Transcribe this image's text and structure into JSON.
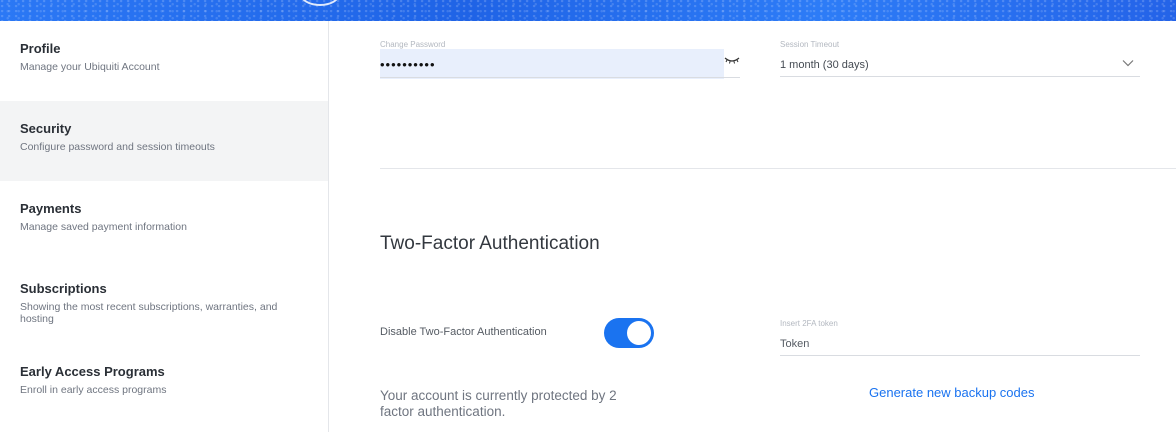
{
  "sidebar": {
    "items": [
      {
        "title": "Profile",
        "desc": "Manage your Ubiquiti Account"
      },
      {
        "title": "Security",
        "desc": "Configure password and session timeouts"
      },
      {
        "title": "Payments",
        "desc": "Manage saved payment information"
      },
      {
        "title": "Subscriptions",
        "desc": "Showing the most recent subscriptions, warranties, and hosting"
      },
      {
        "title": "Early Access Programs",
        "desc": "Enroll in early access programs"
      }
    ]
  },
  "security": {
    "password_label": "Change Password",
    "password_value": "••••••••••",
    "session_label": "Session Timeout",
    "session_value": "1 month (30 days)"
  },
  "two_factor": {
    "title": "Two-Factor Authentication",
    "toggle_label": "Disable Two-Factor Authentication",
    "toggle_on": true,
    "token_label": "Insert 2FA token",
    "token_placeholder": "Token",
    "protected_text": "Your account is currently protected by 2 factor authentication.",
    "backup_link": "Generate new backup codes"
  },
  "colors": {
    "accent": "#1a73f0",
    "header": "#1f6feb"
  }
}
